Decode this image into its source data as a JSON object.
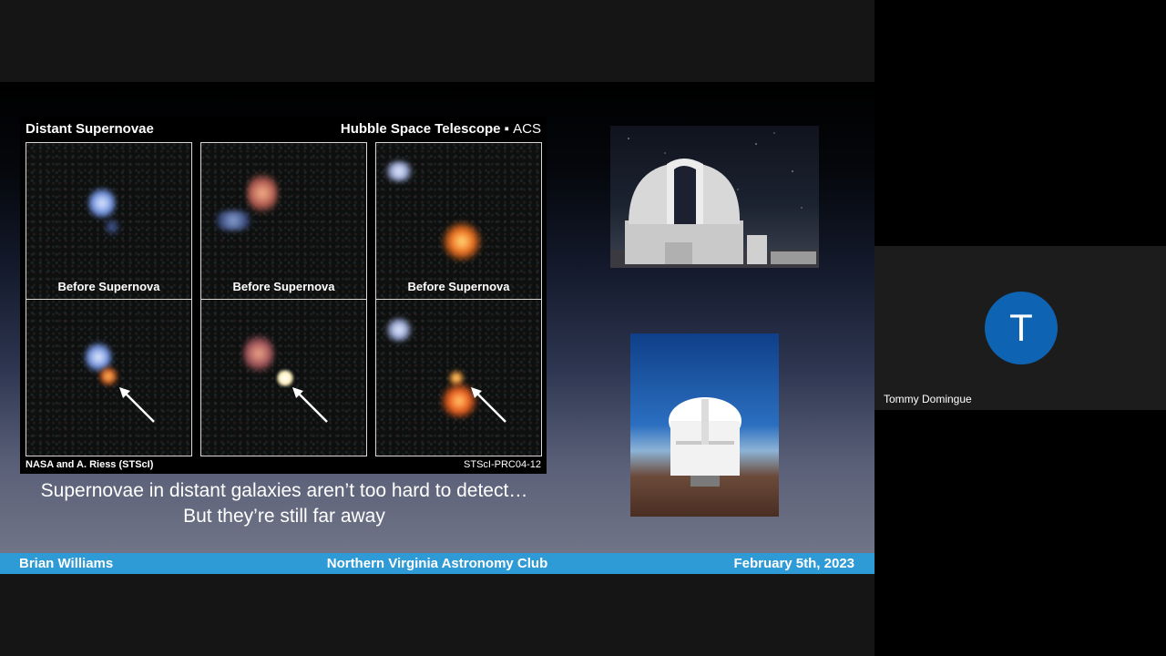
{
  "hubble": {
    "title_left": "Distant Supernovae",
    "title_right_main": "Hubble Space Telescope ▪ ",
    "title_right_instrument": "ACS",
    "panel_caption": "Before Supernova",
    "credit_left": "NASA and A. Riess (STScI)",
    "credit_right": "STScI-PRC04-12"
  },
  "caption": {
    "line1": "Supernovae in distant galaxies aren’t too hard to detect…",
    "line2": "But they’re still far away"
  },
  "footer": {
    "presenter": "Brian Williams",
    "club": "Northern Virginia Astronomy Club",
    "date": "February 5th, 2023"
  },
  "participant": {
    "initial": "T",
    "name": "Tommy Domingue",
    "avatar_color": "#0e64b3"
  },
  "colors": {
    "footer_bar": "#2e9ad6",
    "tile_bg": "#1c1c1c"
  }
}
